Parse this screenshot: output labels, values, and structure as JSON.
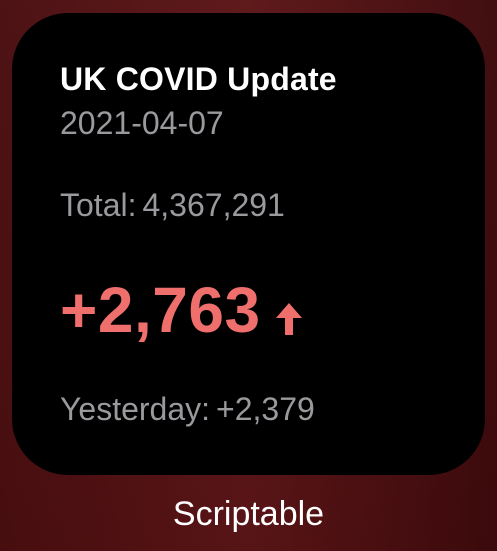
{
  "widget": {
    "title": "UK COVID Update",
    "date": "2021-04-07",
    "total_label": "Total:",
    "total_value": "4,367,291",
    "delta_value": "+2,763",
    "trend_icon": "arrow-up-icon",
    "yesterday_label": "Yesterday:",
    "yesterday_value": "+2,379"
  },
  "app_label": "Scriptable",
  "colors": {
    "widget_background": "#000000",
    "title": "#ffffff",
    "secondary_text": "#9a9a9e",
    "accent_red": "#ee6f6c",
    "wallpaper": "#4a0f10"
  }
}
